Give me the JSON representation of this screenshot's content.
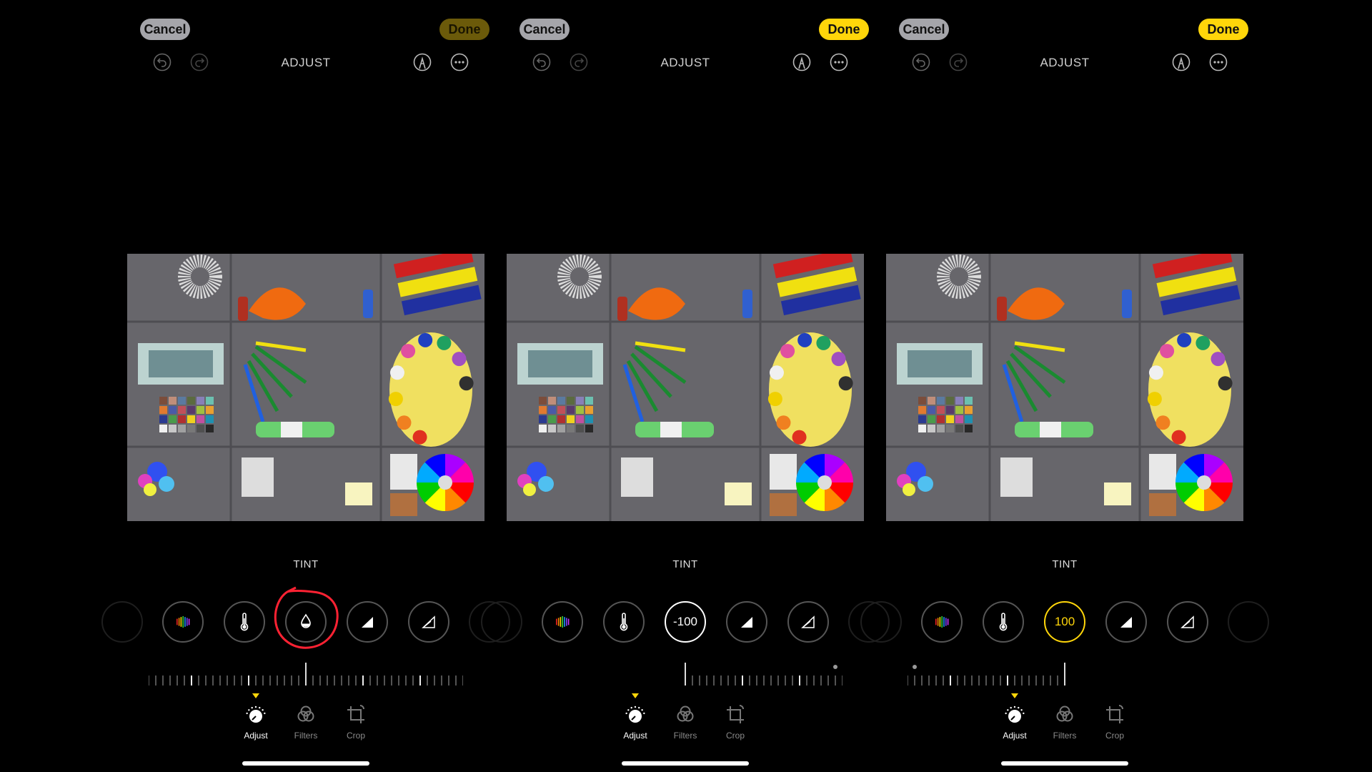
{
  "accent": "#ffd60a",
  "panels": [
    {
      "cancel_label": "Cancel",
      "done_label": "Done",
      "done_enabled": false,
      "title": "ADJUST",
      "tool_label": "TINT",
      "tint_value": "",
      "tint_active": false,
      "slider_value": 0,
      "annotated": true,
      "tabs": [
        {
          "label": "Adjust",
          "icon": "adjust-dial-icon",
          "active": true
        },
        {
          "label": "Filters",
          "icon": "filters-icon"
        },
        {
          "label": "Crop",
          "icon": "crop-icon"
        }
      ]
    },
    {
      "cancel_label": "Cancel",
      "done_label": "Done",
      "done_enabled": true,
      "title": "ADJUST",
      "tool_label": "TINT",
      "tint_value": "-100",
      "tint_active": "white",
      "slider_value": -100,
      "annotated": false,
      "tabs": [
        {
          "label": "Adjust",
          "icon": "adjust-dial-icon",
          "active": true
        },
        {
          "label": "Filters",
          "icon": "filters-icon"
        },
        {
          "label": "Crop",
          "icon": "crop-icon"
        }
      ]
    },
    {
      "cancel_label": "Cancel",
      "done_label": "Done",
      "done_enabled": true,
      "title": "ADJUST",
      "tool_label": "TINT",
      "tint_value": "100",
      "tint_active": "yellow",
      "slider_value": 100,
      "annotated": false,
      "tabs": [
        {
          "label": "Adjust",
          "icon": "adjust-dial-icon",
          "active": true
        },
        {
          "label": "Filters",
          "icon": "filters-icon"
        },
        {
          "label": "Crop",
          "icon": "crop-icon"
        }
      ]
    }
  ],
  "tools": [
    "vibrance-icon",
    "warmth-thermometer-icon",
    "tint-drop-icon",
    "sharpness-icon",
    "definition-icon"
  ]
}
